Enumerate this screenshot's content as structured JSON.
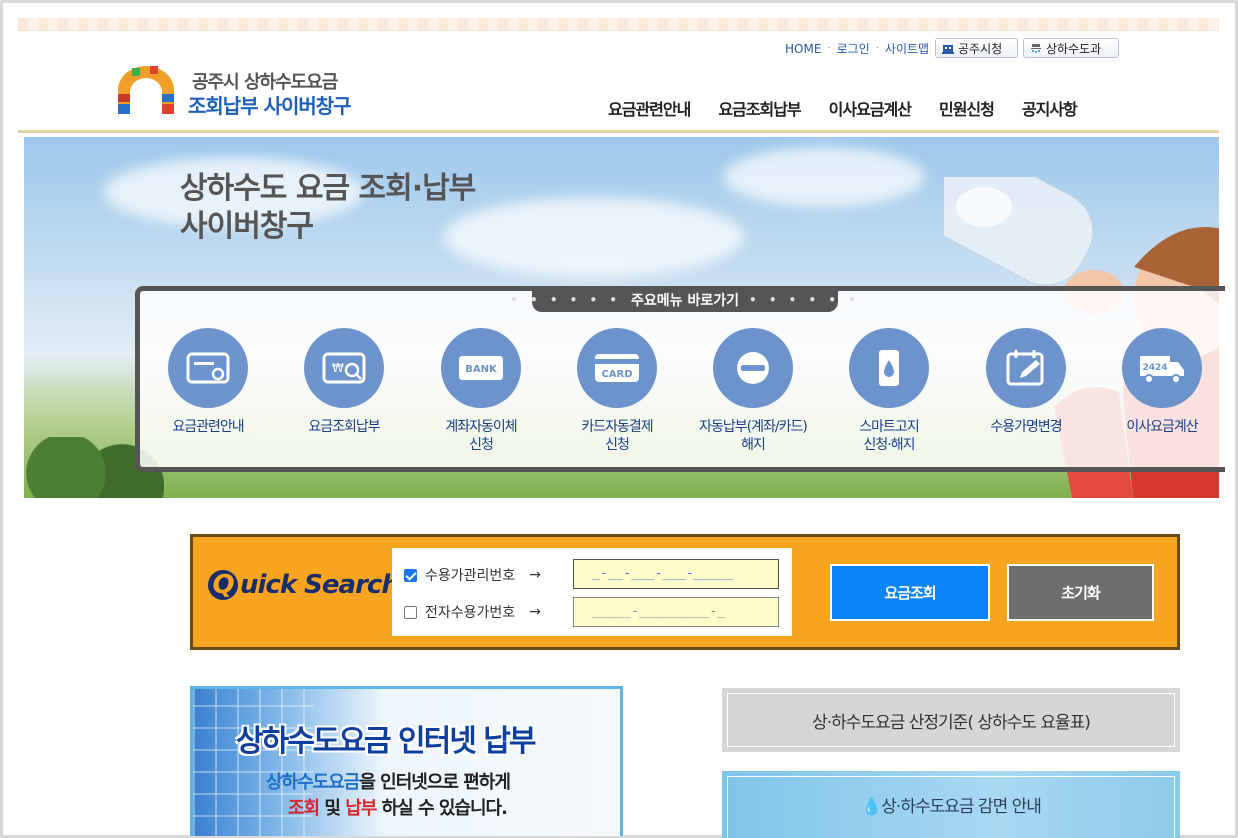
{
  "header": {
    "util_links": [
      "HOME",
      "로그인",
      "사이트맵"
    ],
    "city_button": "공주시청",
    "dept_button": "상하수도과",
    "logo_line1": "공주시 상하수도요금",
    "logo_line2": "조회납부 사이버창구",
    "gnb": [
      "요금관련안내",
      "요금조회납부",
      "이사요금계산",
      "민원신청",
      "공지사항"
    ]
  },
  "hero": {
    "title_line1": "상하수도 요금 조회·납부",
    "title_line2": "사이버창구",
    "quickmenu_title": "주요메뉴 바로가기",
    "quickmenu_dots": "• • • • • •",
    "items": [
      {
        "label": "요금관련안내",
        "icon": "bill-info-icon"
      },
      {
        "label": "요금조회납부",
        "icon": "bill-search-icon"
      },
      {
        "label": "계좌자동이체\n신청",
        "icon": "bank-icon",
        "icon_text": "BANK"
      },
      {
        "label": "카드자동결제\n신청",
        "icon": "card-icon",
        "icon_text": "CARD"
      },
      {
        "label": "자동납부(계좌/카드)\n해지",
        "icon": "cancel-icon"
      },
      {
        "label": "스마트고지\n신청·해지",
        "icon": "smartphone-icon"
      },
      {
        "label": "수용가명변경",
        "icon": "calendar-edit-icon"
      },
      {
        "label": "이사요금계산",
        "icon": "truck-icon",
        "icon_text": "2424"
      }
    ]
  },
  "quick_search": {
    "logo_q": "Q",
    "logo_rest": "uick Search",
    "option1": {
      "label": "수용가관리번호",
      "arrow": "→",
      "checked": true,
      "value": "_-__-___-___-_____"
    },
    "option2": {
      "label": "전자수용가번호",
      "arrow": "→",
      "checked": false,
      "value": "_____-_________-_"
    },
    "search_button": "요금조회",
    "reset_button": "초기화"
  },
  "banner": {
    "title": "상하수도요금 인터넷 납부",
    "line1_highlight": "상하수도요금",
    "line1_rest": "을 인터넷으로  편하게",
    "line2_a": "조회",
    "line2_b": " 및 ",
    "line2_c": "납부",
    "line2_rest": " 하실 수 있습니다."
  },
  "links": {
    "rate_standard": "상·하수도요금 산정기준( 상하수도 요율표)",
    "reduction": "💧상·하수도요금 감면 안내"
  },
  "colors": {
    "accent_blue": "#0a84f7",
    "quick_orange": "#f7a51e",
    "menu_circle": "#6d93cc"
  }
}
